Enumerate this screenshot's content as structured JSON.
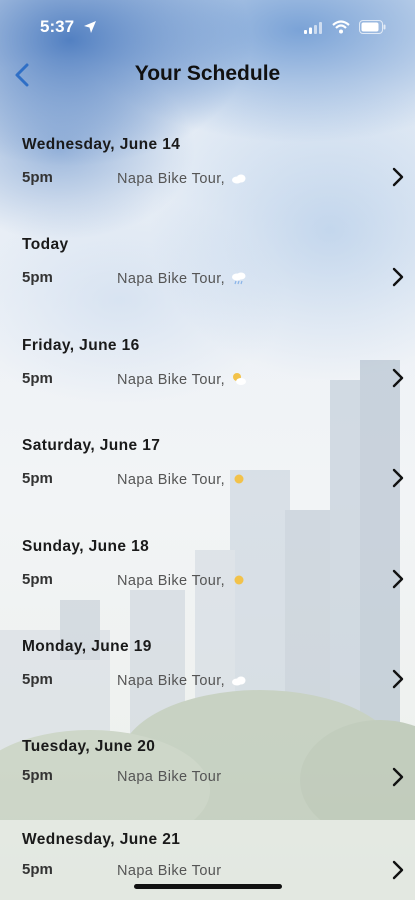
{
  "status": {
    "time": "5:37"
  },
  "nav": {
    "title": "Your Schedule"
  },
  "days": [
    {
      "date": "Wednesday, June 14",
      "time": "5pm",
      "event": "Napa Bike Tour,",
      "weather": "cloud-icon"
    },
    {
      "date": "Today",
      "time": "5pm",
      "event": "Napa Bike Tour,",
      "weather": "rain-cloud-icon"
    },
    {
      "date": "Friday, June 16",
      "time": "5pm",
      "event": "Napa Bike Tour,",
      "weather": "partly-sunny-icon"
    },
    {
      "date": "Saturday, June 17",
      "time": "5pm",
      "event": "Napa Bike Tour,",
      "weather": "sun-icon"
    },
    {
      "date": "Sunday, June 18",
      "time": "5pm",
      "event": "Napa Bike Tour,",
      "weather": "sun-icon"
    },
    {
      "date": "Monday, June 19",
      "time": "5pm",
      "event": "Napa Bike Tour,",
      "weather": "cloud-icon"
    },
    {
      "date": "Tuesday, June 20",
      "time": "5pm",
      "event": "Napa Bike Tour",
      "weather": ""
    },
    {
      "date": "Wednesday, June 21",
      "time": "5pm",
      "event": "Napa Bike Tour",
      "weather": ""
    }
  ],
  "colors": {
    "accent": "#2f6fc6",
    "sun": "#f2c24a",
    "cloud": "#ffffff"
  }
}
